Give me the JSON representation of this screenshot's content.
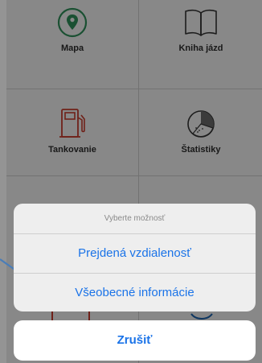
{
  "tiles": [
    {
      "label": "Mapa",
      "icon": "map-pin-icon"
    },
    {
      "label": "Kniha jázd",
      "icon": "book-icon"
    },
    {
      "label": "Tankovanie",
      "icon": "fuel-pump-icon"
    },
    {
      "label": "Štatistiky",
      "icon": "pie-chart-icon"
    }
  ],
  "action_sheet": {
    "title": "Vyberte možnosť",
    "actions": [
      "Prejdená vzdialenosť",
      "Všeobecné informácie"
    ],
    "cancel_label": "Zrušiť"
  },
  "colors": {
    "accent": "#1a73e8",
    "map_icon": "#2e8b57",
    "fuel_icon": "#c0392b",
    "tile_bg": "#ebebeb"
  }
}
